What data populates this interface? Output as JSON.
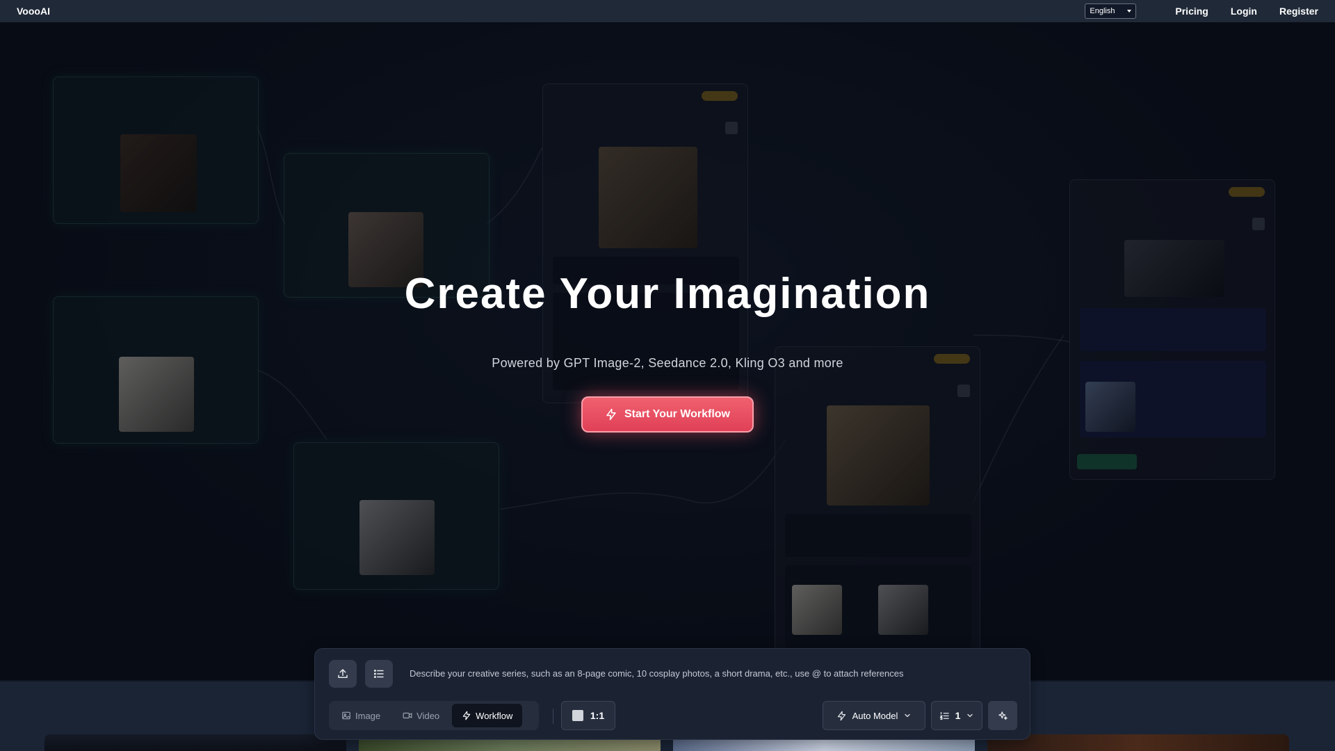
{
  "nav": {
    "logo": "VoooAI",
    "language": "English",
    "pricing": "Pricing",
    "login": "Login",
    "register": "Register"
  },
  "hero": {
    "title": "Create Your Imagination",
    "subtitle": "Powered by GPT Image-2, Seedance 2.0, Kling O3 and more",
    "cta": "Start Your Workflow",
    "cta_icon": "lightning-icon"
  },
  "composer": {
    "upload_icon": "upload-icon",
    "list_icon": "list-icon",
    "prompt_placeholder": "Describe your creative series, such as an 8-page comic, 10 cosplay photos, a short drama, etc., use @ to attach references",
    "modes": [
      {
        "label": "Image",
        "icon": "image-icon",
        "active": false
      },
      {
        "label": "Video",
        "icon": "video-icon",
        "active": false
      },
      {
        "label": "Workflow",
        "icon": "lightning-icon",
        "active": true
      }
    ],
    "aspect_ratio": "1:1",
    "model": "Auto Model",
    "count": "1",
    "enhance_icon": "sparkle-icon"
  },
  "colors": {
    "nav_bg": "#1f2937",
    "cta_accent": "#e8505f",
    "composer_bg": "#1b2232",
    "page_bg": "#0b0f1a"
  }
}
